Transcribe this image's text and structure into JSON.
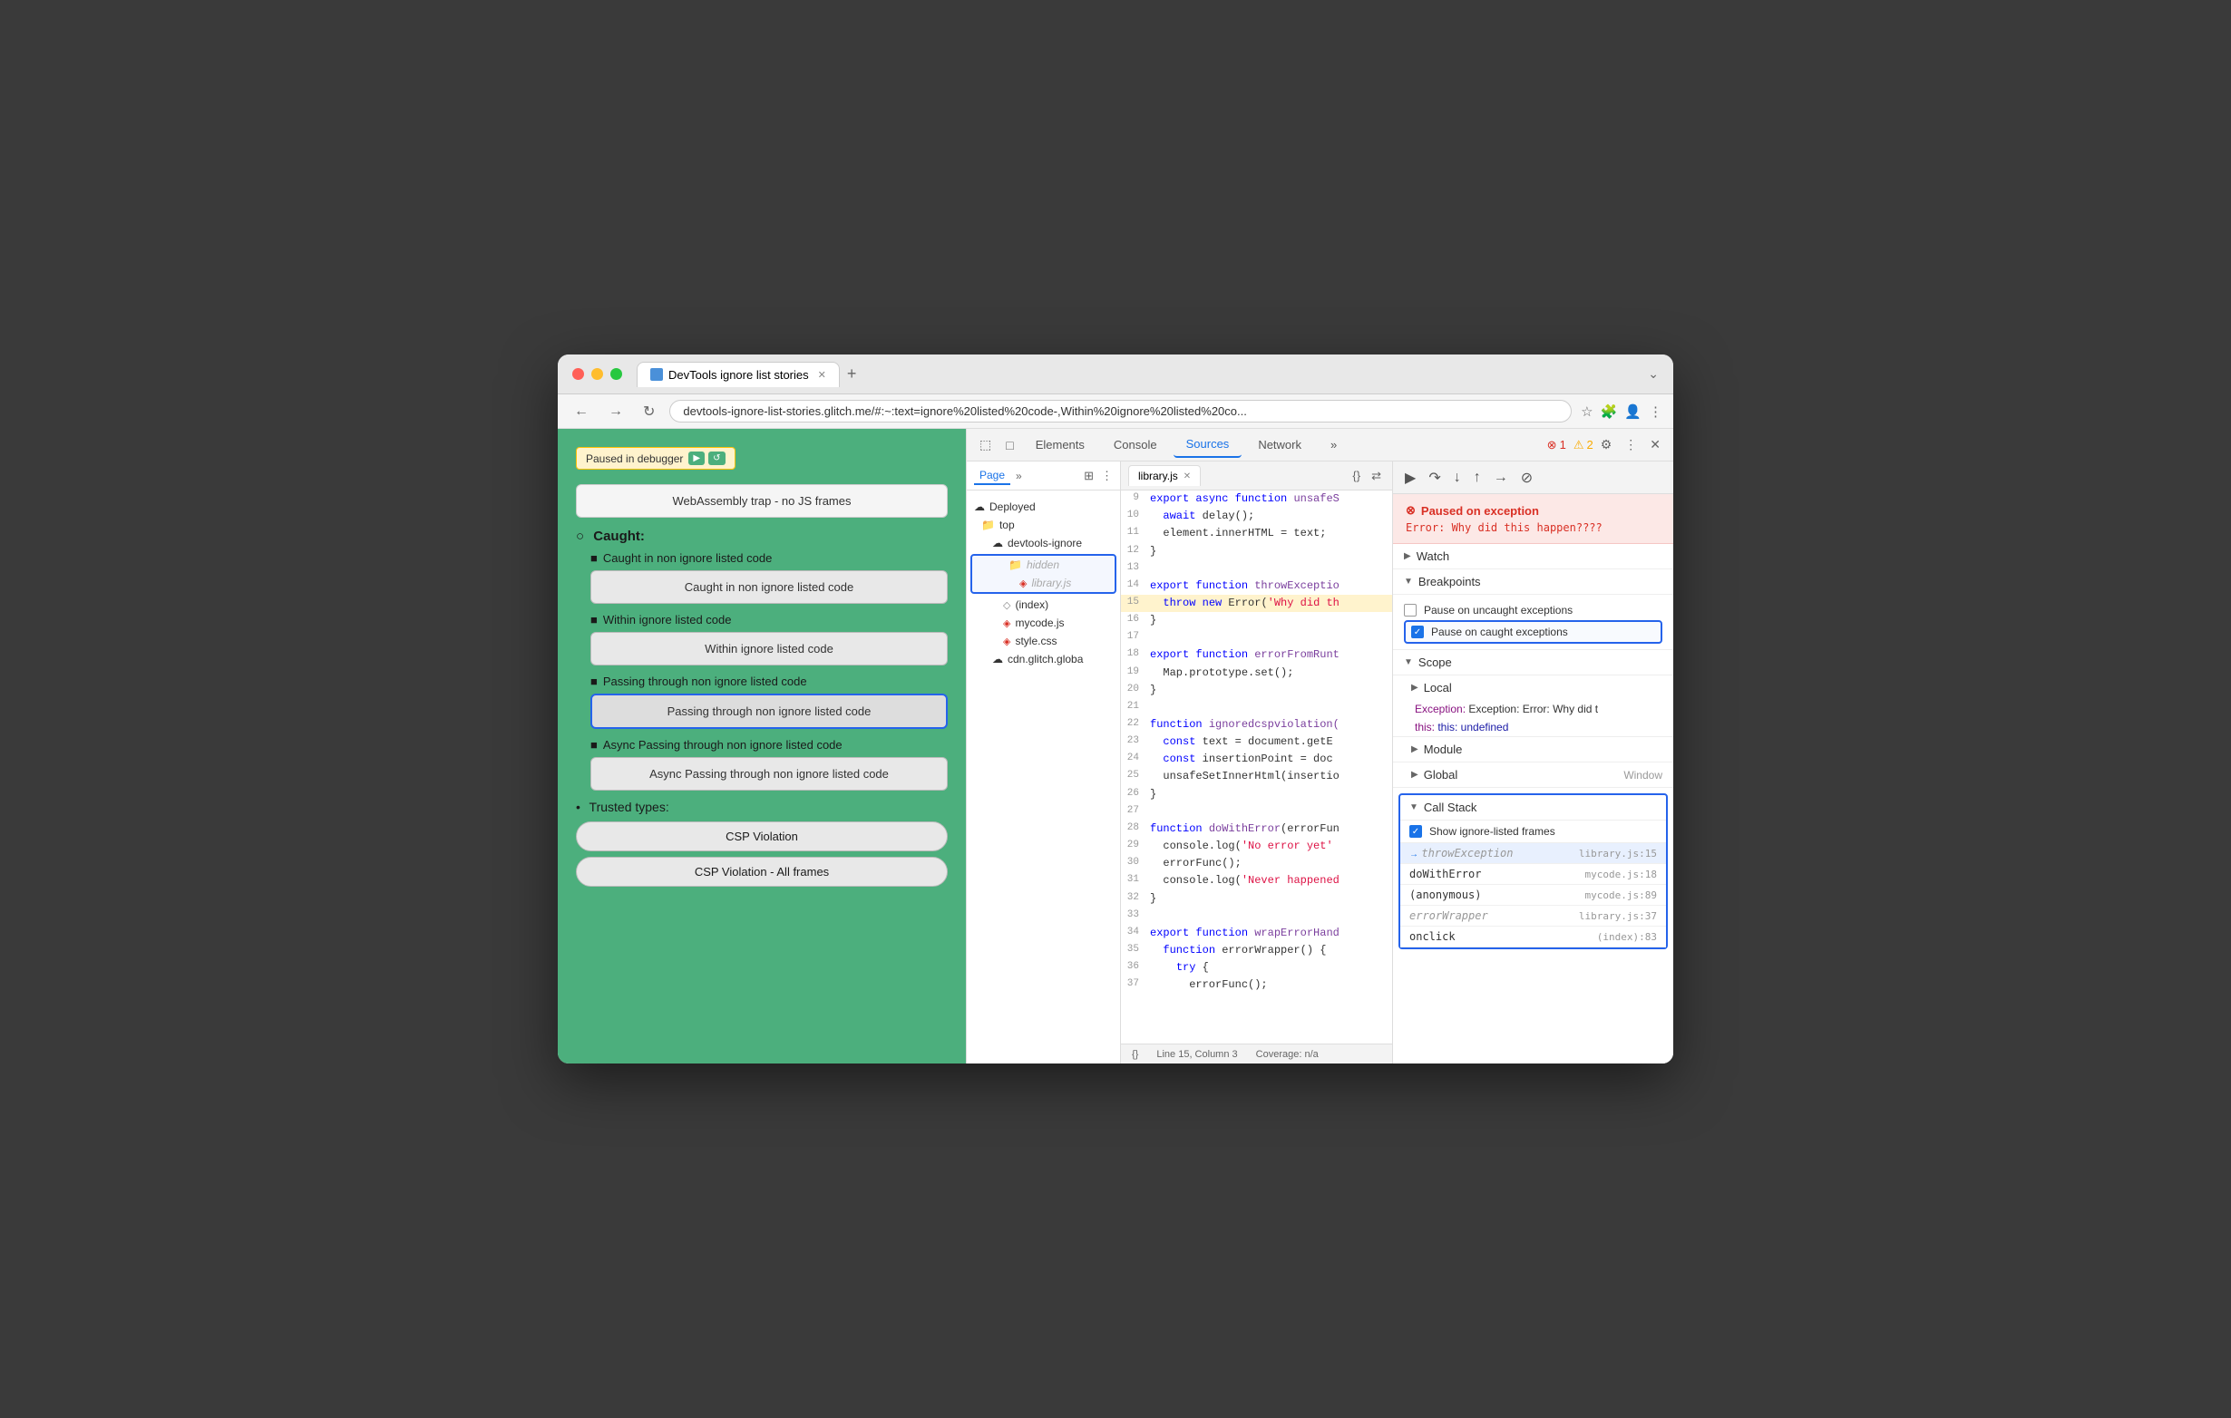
{
  "window": {
    "title": "DevTools ignore list stories"
  },
  "browser": {
    "address": "devtools-ignore-list-stories.glitch.me/#:~:text=ignore%20listed%20code-,Within%20ignore%20listed%20co...",
    "back_disabled": false,
    "forward_disabled": false,
    "tab_label": "DevTools ignore list stories"
  },
  "webpage": {
    "paused_badge": "Paused in debugger",
    "webassembly_label": "WebAssembly trap - no JS frames",
    "caught_section": "Caught:",
    "items": [
      {
        "label": "Caught in non ignore listed code",
        "button": "Caught in non ignore listed code",
        "highlighted": false
      },
      {
        "label": "Within ignore listed code",
        "button": "Within ignore listed code",
        "highlighted": false
      },
      {
        "label": "Passing through non ignore listed code",
        "button": "Passing through non ignore listed code",
        "highlighted": true
      },
      {
        "label": "Async Passing through non ignore listed code",
        "button": "Async Passing through non ignore listed code",
        "highlighted": false
      }
    ],
    "trusted_section": "Trusted types:",
    "trusted_items": [
      "CSP Violation",
      "CSP Violation - All frames"
    ]
  },
  "devtools": {
    "tabs": [
      "Elements",
      "Console",
      "Sources",
      "Network"
    ],
    "active_tab": "Sources",
    "error_count": "1",
    "warn_count": "2"
  },
  "sources_sidebar": {
    "tabs": [
      "Page"
    ],
    "tree": {
      "deployed": "Deployed",
      "top": "top",
      "devtools_ignore": "devtools-ignore",
      "hidden": "hidden",
      "library_js": "library.js",
      "index": "(index)",
      "mycode_js": "mycode.js",
      "style_css": "style.css",
      "cdn_glitch": "cdn.glitch.globa"
    }
  },
  "code_editor": {
    "file_name": "library.js",
    "lines": [
      {
        "num": "9",
        "content": "export async function unsafeS",
        "highlight": false
      },
      {
        "num": "10",
        "content": "  await delay();",
        "highlight": false
      },
      {
        "num": "11",
        "content": "  element.innerHTML = text;",
        "highlight": false
      },
      {
        "num": "12",
        "content": "}",
        "highlight": false
      },
      {
        "num": "13",
        "content": "",
        "highlight": false
      },
      {
        "num": "14",
        "content": "export function throwExceptio",
        "highlight": false
      },
      {
        "num": "15",
        "content": "  throw new Error('Why did th",
        "highlight": true
      },
      {
        "num": "16",
        "content": "}",
        "highlight": false
      },
      {
        "num": "17",
        "content": "",
        "highlight": false
      },
      {
        "num": "18",
        "content": "export function errorFromRunt",
        "highlight": false
      },
      {
        "num": "19",
        "content": "  Map.prototype.set();",
        "highlight": false
      },
      {
        "num": "20",
        "content": "}",
        "highlight": false
      },
      {
        "num": "21",
        "content": "",
        "highlight": false
      },
      {
        "num": "22",
        "content": "function ignoredcspviolation(",
        "highlight": false
      },
      {
        "num": "23",
        "content": "  const text = document.getE",
        "highlight": false
      },
      {
        "num": "24",
        "content": "  const insertionPoint = doc",
        "highlight": false
      },
      {
        "num": "25",
        "content": "  unsafeSetInnerHtml(insertio",
        "highlight": false
      },
      {
        "num": "26",
        "content": "}",
        "highlight": false
      },
      {
        "num": "27",
        "content": "",
        "highlight": false
      },
      {
        "num": "28",
        "content": "function doWithError(errorFun",
        "highlight": false
      },
      {
        "num": "29",
        "content": "  console.log('No error yet'",
        "highlight": false
      },
      {
        "num": "30",
        "content": "  errorFunc();",
        "highlight": false
      },
      {
        "num": "31",
        "content": "  console.log('Never happened",
        "highlight": false
      },
      {
        "num": "32",
        "content": "}",
        "highlight": false
      },
      {
        "num": "33",
        "content": "",
        "highlight": false
      },
      {
        "num": "34",
        "content": "export function wrapErrorHand",
        "highlight": false
      },
      {
        "num": "35",
        "content": "  function errorWrapper() {",
        "highlight": false
      },
      {
        "num": "36",
        "content": "    try {",
        "highlight": false
      },
      {
        "num": "37",
        "content": "      errorFunc();",
        "highlight": false
      }
    ],
    "status_line": "Line 15, Column 3",
    "status_coverage": "Coverage: n/a"
  },
  "debugger": {
    "toolbar_icons": [
      "resume",
      "step-over",
      "step-into",
      "step-out",
      "step",
      "deactivate"
    ],
    "exception": {
      "title": "Paused on exception",
      "message": "Error: Why did this happen????"
    },
    "sections": {
      "watch": "Watch",
      "breakpoints": "Breakpoints",
      "pause_uncaught": "Pause on uncaught exceptions",
      "pause_caught": "Pause on caught exceptions",
      "scope": "Scope",
      "local": "Local",
      "exception_label": "Exception: Error: Why did t",
      "this_label": "this: undefined",
      "module": "Module",
      "global": "Global",
      "global_val": "Window",
      "call_stack": "Call Stack",
      "show_ignore": "Show ignore-listed frames"
    },
    "call_stack": [
      {
        "fn": "throwException",
        "loc": "library.js:15",
        "active": true,
        "dimmed": true,
        "arrow": true
      },
      {
        "fn": "doWithError",
        "loc": "mycode.js:18",
        "active": false,
        "dimmed": false,
        "arrow": false
      },
      {
        "fn": "(anonymous)",
        "loc": "mycode.js:89",
        "active": false,
        "dimmed": false,
        "arrow": false
      },
      {
        "fn": "errorWrapper",
        "loc": "library.js:37",
        "active": false,
        "dimmed": true,
        "arrow": false
      },
      {
        "fn": "onclick",
        "loc": "(index):83",
        "active": false,
        "dimmed": false,
        "arrow": false
      }
    ]
  }
}
